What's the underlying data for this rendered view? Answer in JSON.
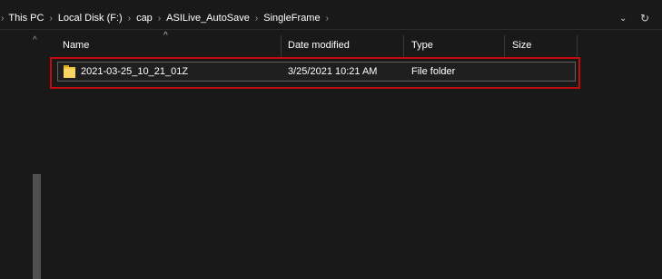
{
  "breadcrumb": {
    "items": [
      "This PC",
      "Local Disk (F:)",
      "cap",
      "ASILive_AutoSave",
      "SingleFrame"
    ],
    "separator": "›"
  },
  "header": {
    "columns": [
      "Name",
      "Date modified",
      "Type",
      "Size"
    ],
    "sort_indicator": "^"
  },
  "files": [
    {
      "name": "2021-03-25_10_21_01Z",
      "date_modified": "3/25/2021 10:21 AM",
      "type": "File folder",
      "size": ""
    }
  ],
  "icons": {
    "address_dropdown": "chevron-down-icon",
    "refresh": "refresh-icon",
    "folder": "folder-icon",
    "scroll_up": "scroll-up-arrow-icon"
  },
  "colors": {
    "background": "#191919",
    "highlight_box": "#c40c0c",
    "folder": "#f4c33b"
  }
}
